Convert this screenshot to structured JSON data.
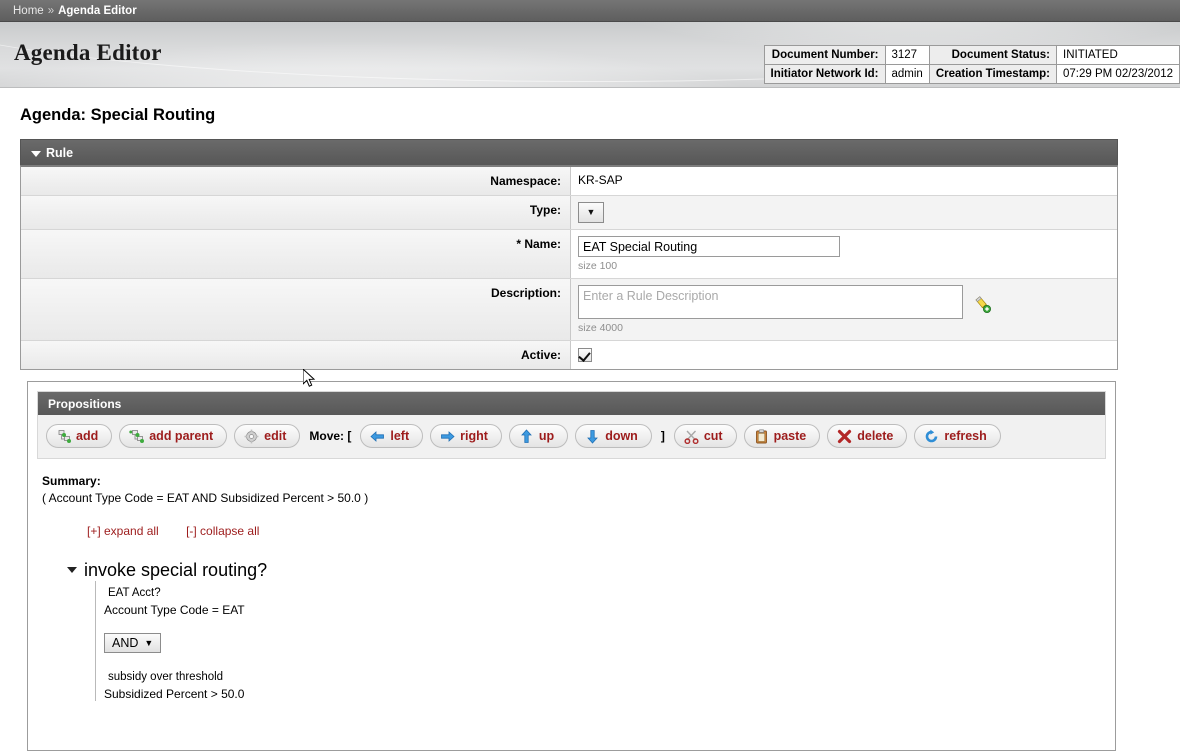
{
  "breadcrumb": {
    "home": "Home",
    "separator": "»",
    "current": "Agenda Editor"
  },
  "header": {
    "app_title": "Agenda Editor"
  },
  "document_info": {
    "rows": [
      {
        "label1": "Document Number:",
        "value1": "3127",
        "label2": "Document Status:",
        "value2": "INITIATED"
      },
      {
        "label1": "Initiator Network Id:",
        "value1": "admin",
        "label2": "Creation Timestamp:",
        "value2": "07:29 PM 02/23/2012"
      }
    ]
  },
  "page": {
    "title": "Agenda: Special Routing"
  },
  "rule_section": {
    "heading": "Rule",
    "fields": {
      "namespace_label": "Namespace:",
      "namespace_value": "KR-SAP",
      "type_label": "Type:",
      "type_selected": "",
      "type_caret": "▼",
      "name_label": "* Name:",
      "name_value": "EAT Special Routing",
      "name_hint": "size 100",
      "description_label": "Description:",
      "description_value": "",
      "description_placeholder": "Enter a Rule Description",
      "description_hint": "size 4000",
      "description_edit_icon": "pencil-plus-icon",
      "active_label": "Active:",
      "active_checked": true
    }
  },
  "propositions": {
    "heading": "Propositions",
    "toolbar": {
      "buttons": [
        {
          "label": "add",
          "icon": "tree-node-add-icon"
        },
        {
          "label": "add parent",
          "icon": "tree-node-add-parent-icon"
        },
        {
          "label": "edit",
          "icon": "gear-icon"
        }
      ],
      "move_label": "Move: [",
      "move_buttons": [
        {
          "label": "left",
          "icon": "arrow-left-icon"
        },
        {
          "label": "right",
          "icon": "arrow-right-icon"
        },
        {
          "label": "up",
          "icon": "arrow-up-icon"
        },
        {
          "label": "down",
          "icon": "arrow-down-icon"
        }
      ],
      "move_close": "]",
      "action_buttons": [
        {
          "label": "cut",
          "icon": "scissors-icon"
        },
        {
          "label": "paste",
          "icon": "clipboard-icon"
        },
        {
          "label": "delete",
          "icon": "x-mark-icon"
        },
        {
          "label": "refresh",
          "icon": "refresh-icon"
        }
      ]
    },
    "summary_label": "Summary:",
    "summary_text": "( Account Type Code = EAT AND Subsidized Percent > 50.0 )",
    "expand_all": "[+] expand all",
    "collapse_all": "[-] collapse all",
    "tree": {
      "root_label": "invoke special routing?",
      "root_expanded": true,
      "children": [
        {
          "name": "EAT Acct?",
          "expression": "Account Type Code = EAT"
        },
        {
          "operator": "AND",
          "operator_caret": "▼"
        },
        {
          "name": "subsidy over threshold",
          "expression": "Subsidized Percent > 50.0"
        }
      ]
    }
  },
  "colors": {
    "breadcrumb_bar": "#686868",
    "section_header": "#5f5f5f",
    "button_text": "#9d1c1c",
    "link": "#9d1c1c",
    "label_column": "#eeeeee"
  }
}
